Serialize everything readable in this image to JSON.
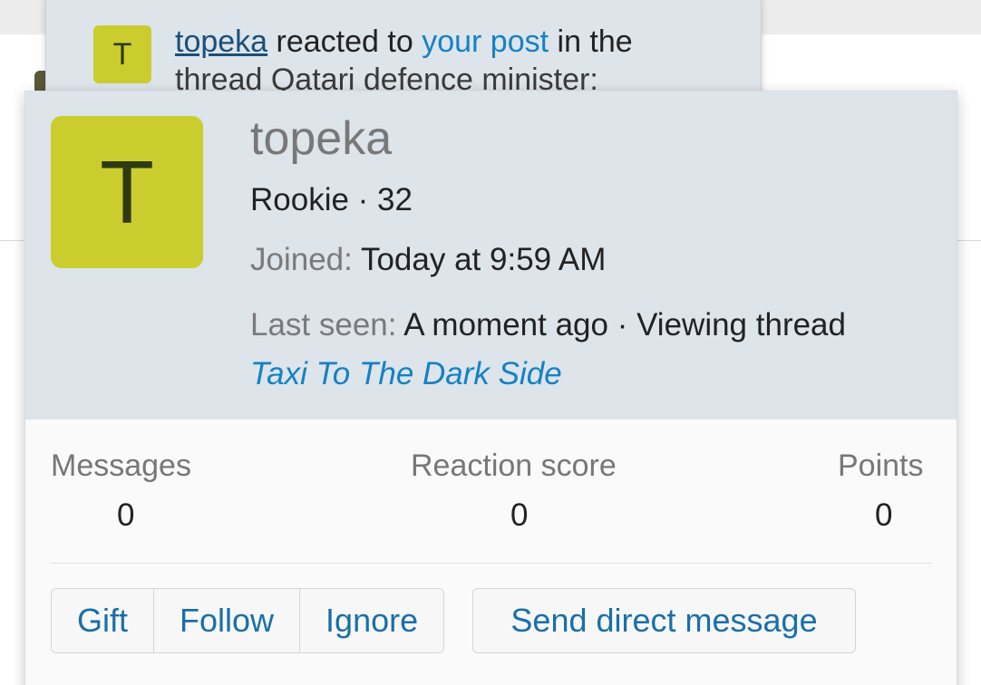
{
  "alert": {
    "avatar_letter": "T",
    "user_link": "topeka",
    "text_mid": " reacted to ",
    "post_link": "your post",
    "text_end": " in the",
    "line2": "thread Qatari defence minister:"
  },
  "member_card": {
    "avatar_letter": "T",
    "avatar_color": "#cbcd2f",
    "username": "topeka",
    "user_title": "Rookie · 32",
    "joined_label": "Joined:",
    "joined_value": "Today at 9:59 AM",
    "last_seen_label": "Last seen:",
    "last_seen_value": "A moment ago · Viewing thread",
    "thread_link": "Taxi To The Dark Side"
  },
  "stats": [
    {
      "label": "Messages",
      "value": "0"
    },
    {
      "label": "Reaction score",
      "value": "0"
    },
    {
      "label": "Points",
      "value": "0"
    }
  ],
  "actions": {
    "gift": "Gift",
    "follow": "Follow",
    "ignore": "Ignore",
    "send_dm": "Send direct message"
  },
  "colors": {
    "header_bg": "#dde4ea",
    "link": "#1582c4",
    "button_text": "#1a6fa8"
  }
}
